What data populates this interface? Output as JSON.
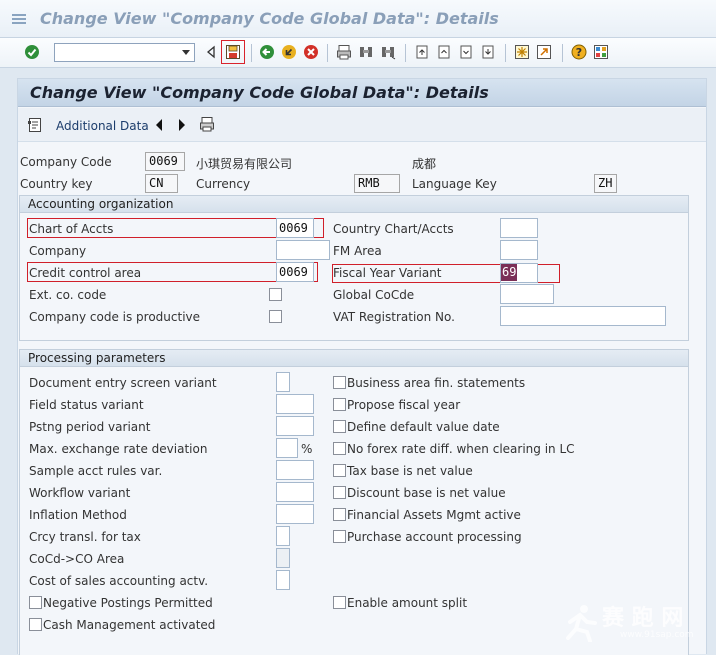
{
  "window": {
    "title": "Change View \"Company Code Global Data\": Details"
  },
  "toolbar": {
    "command_field": {
      "value": "",
      "placeholder": ""
    },
    "icons": [
      "enter-icon",
      "command-field",
      "save-icon",
      "back-icon",
      "exit-icon",
      "cancel-icon",
      "print-icon",
      "find-icon",
      "find-next-icon",
      "first-page-icon",
      "previous-page-icon",
      "next-page-icon",
      "last-page-icon",
      "create-session-icon",
      "shortcut-icon",
      "help-icon",
      "customize-layout-icon"
    ]
  },
  "screen": {
    "title": "Change View \"Company Code Global Data\": Details",
    "app_toolbar": {
      "additional_data_label": "Additional Data"
    }
  },
  "header": {
    "company_code": {
      "label": "Company Code",
      "value": "0069",
      "name": "小琪贸易有限公司",
      "city": "成都"
    },
    "country_key": {
      "label": "Country key",
      "value": "CN"
    },
    "currency": {
      "label": "Currency",
      "value": "RMB"
    },
    "language_key": {
      "label": "Language Key",
      "value": "ZH"
    }
  },
  "accounting_org": {
    "title": "Accounting organization",
    "chart_of_accts": {
      "label": "Chart of Accts",
      "value": "0069"
    },
    "company": {
      "label": "Company",
      "value": ""
    },
    "credit_control_area": {
      "label": "Credit control area",
      "value": "0069"
    },
    "ext_co_code": {
      "label": "Ext. co. code",
      "checked": false
    },
    "productive": {
      "label": "Company code is productive",
      "checked": false
    },
    "country_chart": {
      "label": "Country Chart/Accts",
      "value": ""
    },
    "fm_area": {
      "label": "FM Area",
      "value": ""
    },
    "fiscal_year_variant": {
      "label": "Fiscal Year Variant",
      "value": "69"
    },
    "global_cocde": {
      "label": "Global CoCde",
      "value": ""
    },
    "vat_reg": {
      "label": "VAT Registration No.",
      "value": ""
    }
  },
  "processing": {
    "title": "Processing parameters",
    "left_fields": [
      {
        "label": "Document entry screen variant",
        "value": ""
      },
      {
        "label": "Field status variant",
        "value": ""
      },
      {
        "label": "Pstng period variant",
        "value": ""
      },
      {
        "label": "Max. exchange rate deviation",
        "value": "",
        "unit": "%"
      },
      {
        "label": "Sample acct rules var.",
        "value": ""
      },
      {
        "label": "Workflow variant",
        "value": ""
      },
      {
        "label": "Inflation Method",
        "value": ""
      },
      {
        "label": "Crcy transl. for tax",
        "value": ""
      },
      {
        "label": "CoCd->CO Area",
        "value": ""
      },
      {
        "label": "Cost of sales accounting actv.",
        "value": ""
      }
    ],
    "left_checks": [
      {
        "label": "Negative Postings Permitted",
        "checked": false
      },
      {
        "label": "Cash Management activated",
        "checked": false
      }
    ],
    "right_checks": [
      {
        "label": "Business area fin. statements",
        "checked": false
      },
      {
        "label": "Propose fiscal year",
        "checked": false
      },
      {
        "label": "Define default value date",
        "checked": false
      },
      {
        "label": "No forex rate diff. when clearing in LC",
        "checked": false
      },
      {
        "label": "Tax base is net value",
        "checked": false
      },
      {
        "label": "Discount base is net value",
        "checked": false
      },
      {
        "label": "Financial Assets Mgmt active",
        "checked": false
      },
      {
        "label": "Purchase account processing",
        "checked": false
      },
      {
        "label": "Enable amount split",
        "checked": false
      }
    ]
  },
  "watermark": {
    "brand": "赛 跑 网",
    "url": "www.91sap.com"
  }
}
